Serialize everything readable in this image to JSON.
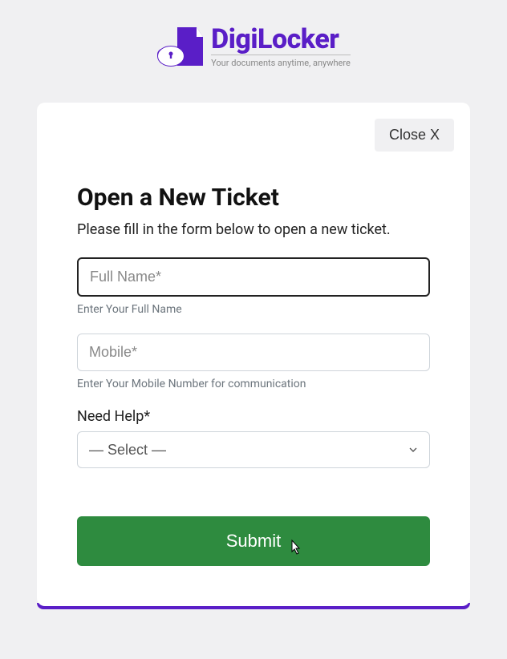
{
  "brand": {
    "name": "DigiLocker",
    "tagline": "Your documents anytime, anywhere"
  },
  "modal": {
    "close_label": "Close X",
    "title": "Open a New Ticket",
    "subtitle": "Please fill in the form below to open a new ticket."
  },
  "form": {
    "fullname": {
      "placeholder": "Full Name*",
      "help": "Enter Your Full Name",
      "value": ""
    },
    "mobile": {
      "placeholder": "Mobile*",
      "help": "Enter Your Mobile Number for communication",
      "value": ""
    },
    "need_help": {
      "label": "Need Help*",
      "selected": "— Select —"
    },
    "submit_label": "Submit"
  },
  "colors": {
    "brand": "#5a1ec7",
    "success": "#2e8b3f",
    "background": "#f0f0f2",
    "card": "#ffffff"
  }
}
